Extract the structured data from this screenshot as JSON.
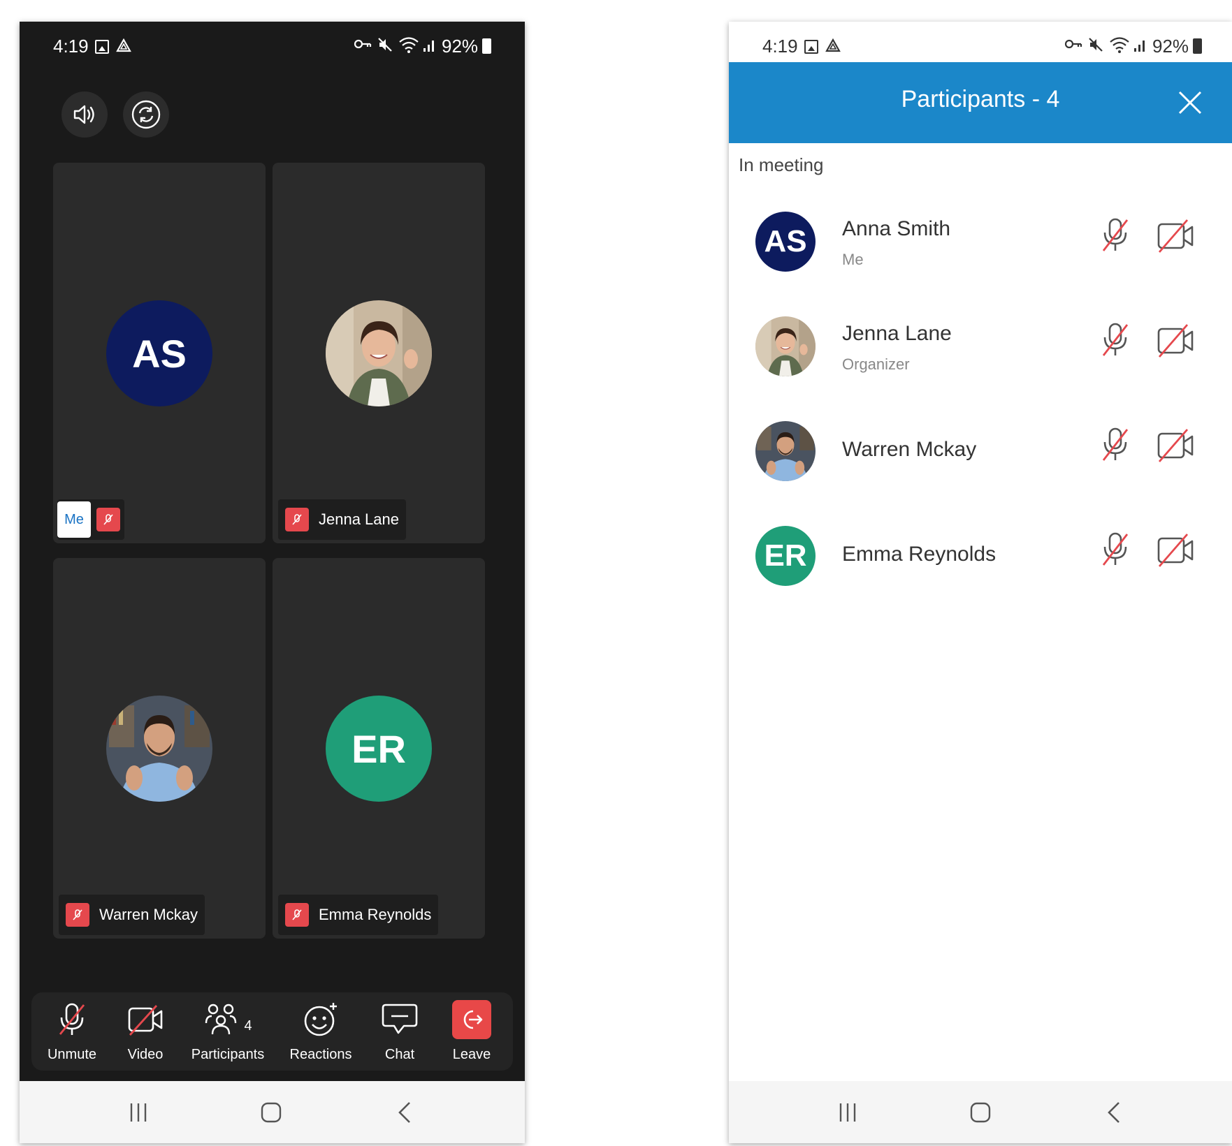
{
  "status_bar": {
    "time": "4:19",
    "battery": "92%",
    "icons": [
      "image-icon",
      "drive-icon",
      "vpn-key-icon",
      "mute-icon",
      "wifi-icon",
      "signal-icon",
      "battery-icon"
    ]
  },
  "meeting_view": {
    "tiles": [
      {
        "name": "Anna Smith",
        "initials": "AS",
        "avatar_color": "#0d1b5e",
        "self_label": "Me",
        "muted": true
      },
      {
        "name": "Jenna Lane",
        "initials": "",
        "avatar_kind": "photo",
        "muted": true
      },
      {
        "name": "Warren Mckay",
        "initials": "",
        "avatar_kind": "photo",
        "muted": true
      },
      {
        "name": "Emma Reynolds",
        "initials": "ER",
        "avatar_color": "#1f9e78",
        "muted": true
      }
    ],
    "toolbar": {
      "unmute": "Unmute",
      "video": "Video",
      "participants": "Participants",
      "participants_count": "4",
      "reactions": "Reactions",
      "chat": "Chat",
      "leave": "Leave"
    }
  },
  "participants_panel": {
    "title": "Participants - 4",
    "section": "In meeting",
    "participants": [
      {
        "name": "Anna Smith",
        "role": "Me",
        "initials": "AS",
        "avatar_color": "#0d1b5e",
        "mic_muted": true,
        "video_off": true
      },
      {
        "name": "Jenna Lane",
        "role": "Organizer",
        "initials": "",
        "mic_muted": true,
        "video_off": true
      },
      {
        "name": "Warren Mckay",
        "role": "",
        "initials": "",
        "mic_muted": true,
        "video_off": true
      },
      {
        "name": "Emma Reynolds",
        "role": "",
        "initials": "ER",
        "avatar_color": "#1f9e78",
        "mic_muted": true,
        "video_off": true
      }
    ]
  },
  "colors": {
    "accent": "#1b87c9",
    "muted_red": "#e5484d",
    "leave_red": "#e84848",
    "dark_bg": "#1a1a1a",
    "tile_bg": "#2b2b2b"
  }
}
